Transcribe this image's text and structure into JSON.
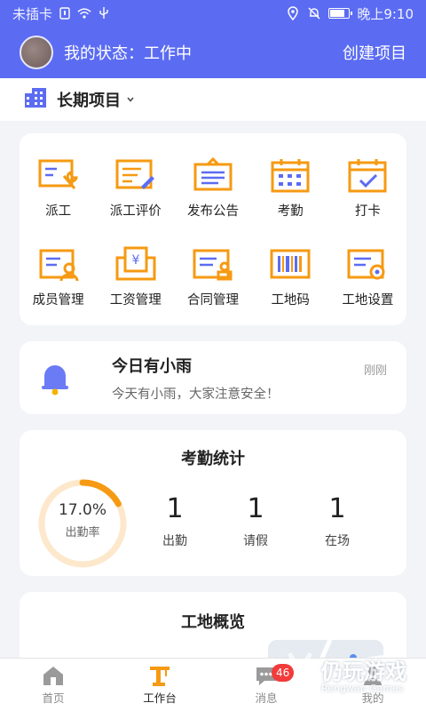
{
  "statusbar": {
    "carrier": "未插卡",
    "time": "晚上9:10"
  },
  "header": {
    "status_label": "我的状态：工作中",
    "create_label": "创建项目"
  },
  "project": {
    "name": "长期项目"
  },
  "functions": [
    {
      "label": "派工",
      "icon": "dispatch-icon"
    },
    {
      "label": "派工评价",
      "icon": "dispatch-review-icon"
    },
    {
      "label": "发布公告",
      "icon": "announcement-icon"
    },
    {
      "label": "考勤",
      "icon": "attendance-calendar-icon"
    },
    {
      "label": "打卡",
      "icon": "checkin-icon"
    },
    {
      "label": "成员管理",
      "icon": "member-management-icon"
    },
    {
      "label": "工资管理",
      "icon": "salary-management-icon"
    },
    {
      "label": "合同管理",
      "icon": "contract-management-icon"
    },
    {
      "label": "工地码",
      "icon": "site-barcode-icon"
    },
    {
      "label": "工地设置",
      "icon": "site-settings-icon"
    }
  ],
  "notice": {
    "title": "今日有小雨",
    "desc": "今天有小雨，大家注意安全！",
    "time": "刚刚"
  },
  "attendance": {
    "title": "考勤统计",
    "rate_value": "17.0%",
    "rate": 0.17,
    "rate_label": "出勤率",
    "stats": [
      {
        "value": "1",
        "label": "出勤"
      },
      {
        "value": "1",
        "label": "请假"
      },
      {
        "value": "1",
        "label": "在场"
      }
    ]
  },
  "site": {
    "title": "工地概览"
  },
  "tabs": [
    {
      "label": "首页",
      "icon": "home-icon"
    },
    {
      "label": "工作台",
      "icon": "workbench-crane-icon"
    },
    {
      "label": "消息",
      "icon": "message-icon",
      "badge": "46"
    },
    {
      "label": "我的",
      "icon": "profile-icon"
    }
  ],
  "watermark": {
    "text": "仍玩游戏",
    "sub": "Rengwan Games"
  },
  "colors": {
    "primary": "#5b6cf2",
    "icon_orange": "#f59a12",
    "bell_blue": "#6b7bf5",
    "badge_red": "#f23b3b"
  }
}
